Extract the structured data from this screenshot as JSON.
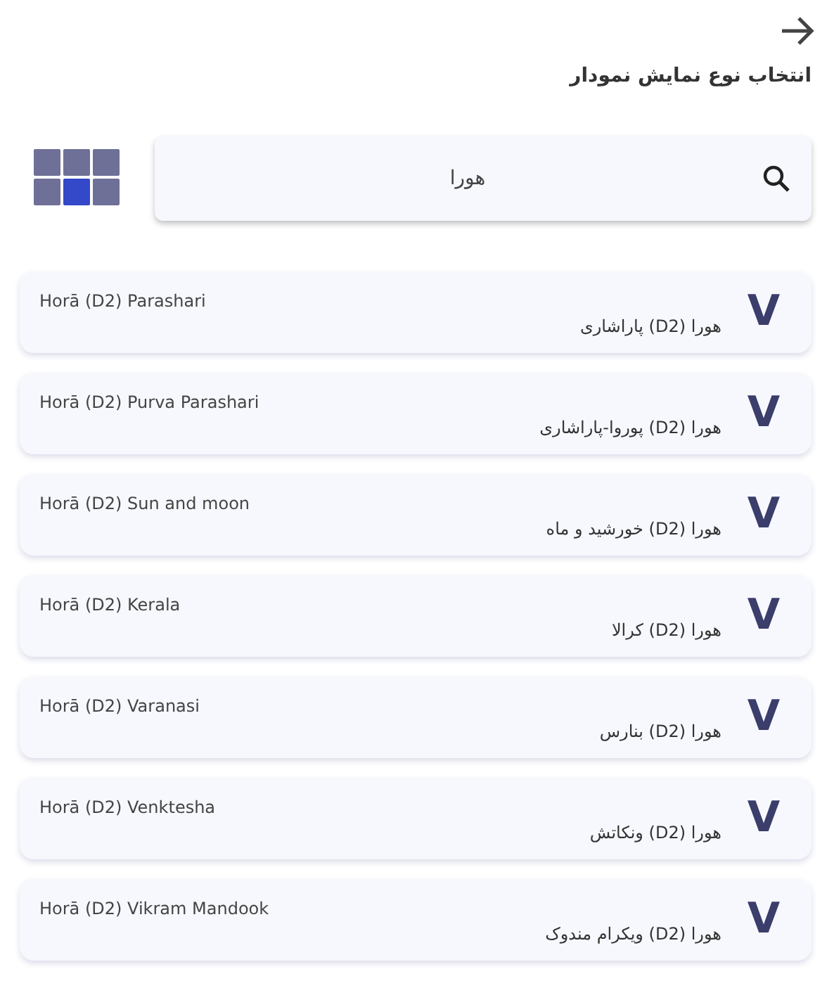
{
  "header": {
    "title": "انتخاب نوع نمایش نمودار"
  },
  "search": {
    "value": "هورا"
  },
  "items": [
    {
      "latin": "Horā (D2) Parashari",
      "persian": "هورا (D2) پاراشاری",
      "badge": "V"
    },
    {
      "latin": "Horā (D2) Purva Parashari",
      "persian": "هورا (D2) پوروا-پاراشاری",
      "badge": "V"
    },
    {
      "latin": "Horā (D2) Sun and moon",
      "persian": "هورا (D2) خورشید و ماه",
      "badge": "V"
    },
    {
      "latin": "Horā (D2) Kerala",
      "persian": "هورا (D2) کرالا",
      "badge": "V"
    },
    {
      "latin": "Horā (D2) Varanasi",
      "persian": "هورا (D2) بنارس",
      "badge": "V"
    },
    {
      "latin": "Horā (D2) Venktesha",
      "persian": "هورا (D2) ونکاتش",
      "badge": "V"
    },
    {
      "latin": "Horā (D2) Vikram Mandook",
      "persian": "هورا (D2) ویکرام مندوک",
      "badge": "V"
    }
  ]
}
